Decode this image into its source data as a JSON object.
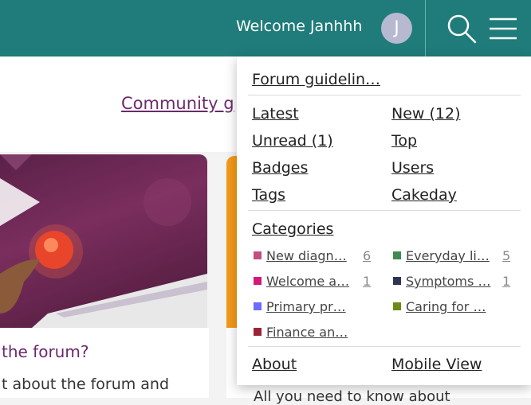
{
  "header": {
    "welcome": "Welcome Janhhh",
    "avatar_letter": "J",
    "bg_color": "#1f7c7a"
  },
  "page": {
    "community_link": "Community g",
    "card_title": "the forum?",
    "card_text": "t about the forum and",
    "bottom_text": "All you need to know about"
  },
  "menu": {
    "guidelines": "Forum guidelin…",
    "links": {
      "latest": "Latest",
      "new": "New (12)",
      "unread": "Unread (1)",
      "top": "Top",
      "badges": "Badges",
      "users": "Users",
      "tags": "Tags",
      "cakeday": "Cakeday"
    },
    "categories_label": "Categories",
    "categories": [
      {
        "name": "New diagn…",
        "count": "6",
        "color": "#c0507f"
      },
      {
        "name": "Everyday li…",
        "count": "5",
        "color": "#3f8a4f"
      },
      {
        "name": "Welcome a…",
        "count": "1",
        "color": "#d4197a"
      },
      {
        "name": "Symptoms …",
        "count": "1",
        "color": "#2e3454"
      },
      {
        "name": "Primary pr…",
        "count": "",
        "color": "#6b6bff"
      },
      {
        "name": "Caring for …",
        "count": "",
        "color": "#6a8a1a"
      },
      {
        "name": "Finance an…",
        "count": "",
        "color": "#9b2335"
      }
    ],
    "about": "About",
    "mobile_view": "Mobile View"
  }
}
